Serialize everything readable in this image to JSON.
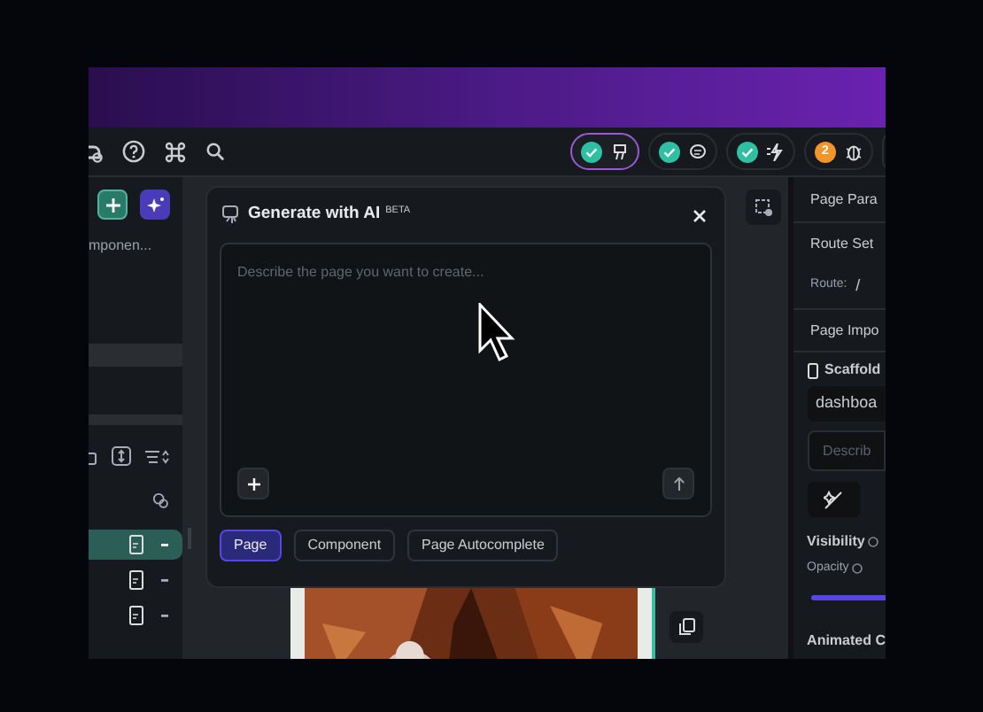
{
  "toolbar": {
    "pills": [
      {
        "kind": "check",
        "highlighted": true
      },
      {
        "kind": "check",
        "highlighted": false
      },
      {
        "kind": "check",
        "highlighted": false
      },
      {
        "kind": "count",
        "count": "2",
        "highlighted": false
      }
    ]
  },
  "left_panel": {
    "label": "mponen...",
    "rows": [
      {
        "selected": true
      },
      {
        "selected": false
      },
      {
        "selected": false
      }
    ]
  },
  "modal": {
    "title": "Generate with AI",
    "badge": "BETA",
    "placeholder": "Describe the page you want to create...",
    "modes": [
      {
        "label": "Page",
        "selected": true
      },
      {
        "label": "Component",
        "selected": false
      },
      {
        "label": "Page Autocomplete",
        "selected": false
      }
    ]
  },
  "right_panel": {
    "page_parameters": "Page Para",
    "route_settings": "Route Set",
    "route_label": "Route:",
    "route_value": "/",
    "page_imports": "Page Impo",
    "scaffold": "Scaffold",
    "name_value": "dashboa",
    "description_placeholder": "Describ",
    "visibility": "Visibility",
    "opacity": "Opacity",
    "opacity_slider": {
      "level": 1
    },
    "animated": "Animated C"
  }
}
